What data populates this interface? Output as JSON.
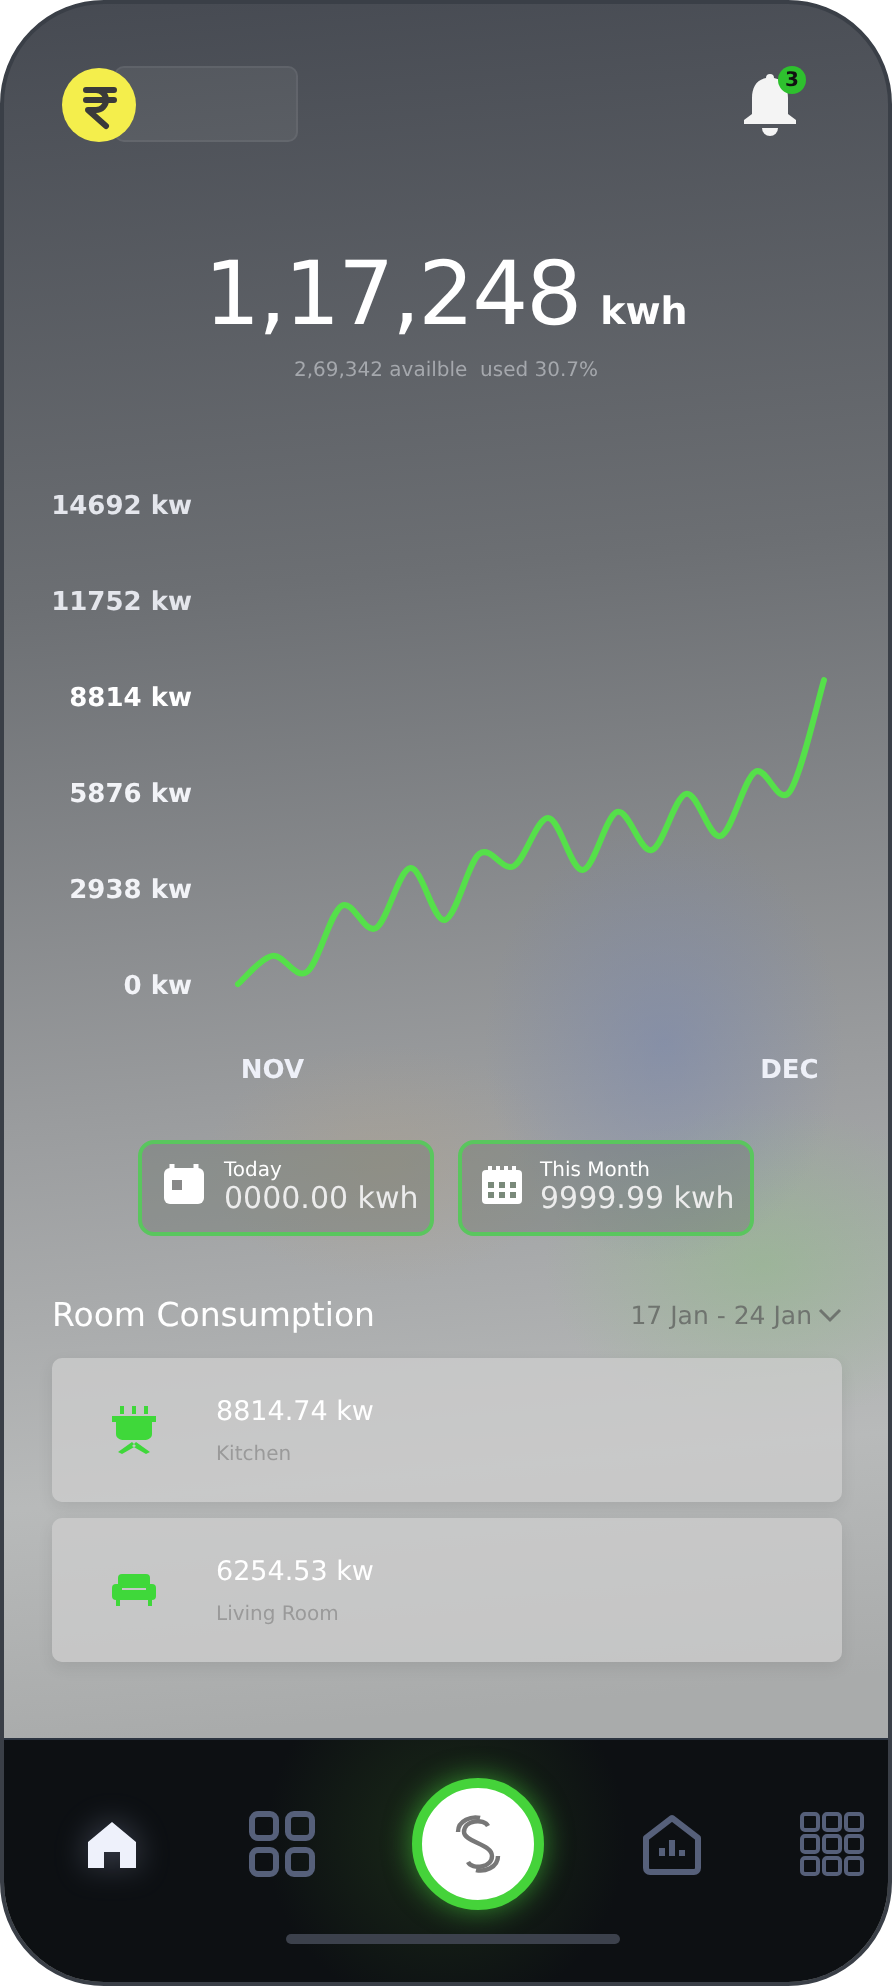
{
  "header": {
    "notification_count": "3"
  },
  "summary": {
    "value": "1,17,248",
    "unit": "kwh",
    "subtitle": "2,69,342 availble  used 30.7%"
  },
  "chart_data": {
    "type": "line",
    "categories": [
      null,
      "NOV",
      null,
      null,
      null,
      null,
      null,
      null,
      null,
      null,
      null,
      null,
      null,
      null,
      null,
      null,
      "DEC",
      null
    ],
    "series": [
      {
        "color": "#55e04a",
        "values": [
          0,
          860,
          370,
          2390,
          1710,
          3550,
          1960,
          3980,
          3610,
          5080,
          3490,
          5270,
          4100,
          5820,
          4530,
          6490,
          5880,
          9300
        ]
      }
    ],
    "ylim": [
      0,
      14692
    ],
    "yticks": [
      {
        "value": 0,
        "label": "0 kw"
      },
      {
        "value": 2938,
        "label": "2938 kw"
      },
      {
        "value": 5876,
        "label": "5876 kw"
      },
      {
        "value": 8814,
        "label": "8814 kw"
      },
      {
        "value": 11752,
        "label": "11752 kw"
      },
      {
        "value": 14692,
        "label": "14692 kw"
      }
    ]
  },
  "stats": [
    {
      "kind": "day",
      "label": "Today",
      "value": "0000.00 kwh"
    },
    {
      "kind": "month",
      "label": "This Month",
      "value": "9999.99 kwh"
    }
  ],
  "rooms": {
    "title": "Room Consumption",
    "date_range": "17 Jan - 24 Jan",
    "items": [
      {
        "kind": "kitchen",
        "value": "8814.74 kw",
        "name": "Kitchen"
      },
      {
        "kind": "sofa",
        "value": "6254.53 kw",
        "name": "Living Room"
      }
    ]
  },
  "nav": [
    {
      "kind": "home",
      "selected": true
    },
    {
      "kind": "grid",
      "selected": false
    },
    {
      "kind": "center",
      "selected": false
    },
    {
      "kind": "stats",
      "selected": false
    },
    {
      "kind": "apps",
      "selected": false
    }
  ]
}
